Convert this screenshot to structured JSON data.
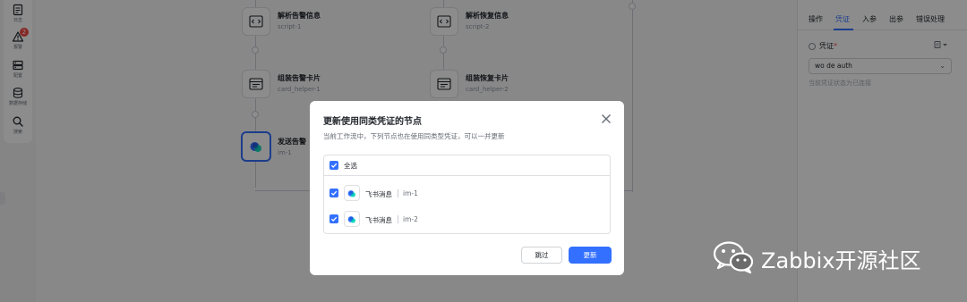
{
  "sidebar": {
    "items": [
      {
        "label": "日志",
        "icon": "log-icon"
      },
      {
        "label": "报警",
        "icon": "warning-icon",
        "badge": "2"
      },
      {
        "label": "配置",
        "icon": "config-icon"
      },
      {
        "label": "数据存储",
        "icon": "database-icon"
      },
      {
        "label": "搜索",
        "icon": "search-icon"
      }
    ]
  },
  "canvas": {
    "nodes": [
      {
        "title": "解析告警信息",
        "sub": "script-1"
      },
      {
        "title": "解析恢复信息",
        "sub": "script-2"
      },
      {
        "title": "组装告警卡片",
        "sub": "card_helper-1"
      },
      {
        "title": "组装恢复卡片",
        "sub": "card_helper-2"
      },
      {
        "title": "发送告警",
        "sub": "im-1"
      }
    ]
  },
  "panel": {
    "tabs": [
      "操作",
      "凭证",
      "入参",
      "出参",
      "错误处理"
    ],
    "active_tab": "凭证",
    "credential_label": "凭证",
    "required_mark": "*",
    "credential_value": "wo de auth",
    "hint": "当前凭证状态为已连接"
  },
  "modal": {
    "title": "更新使用同类凭证的节点",
    "description": "当前工作流中，下列节点也在使用同类型凭证，可以一并更新",
    "select_all": "全选",
    "rows": [
      {
        "name": "飞书消息",
        "id": "im-1",
        "checked": true
      },
      {
        "name": "飞书消息",
        "id": "im-2",
        "checked": true
      }
    ],
    "skip_label": "跳过",
    "update_label": "更新"
  },
  "watermark": {
    "text": "Zabbix开源社区"
  },
  "colors": {
    "accent": "#3370ff",
    "overlay": "rgba(0,0,0,0.45)",
    "badge": "#f54a45"
  }
}
